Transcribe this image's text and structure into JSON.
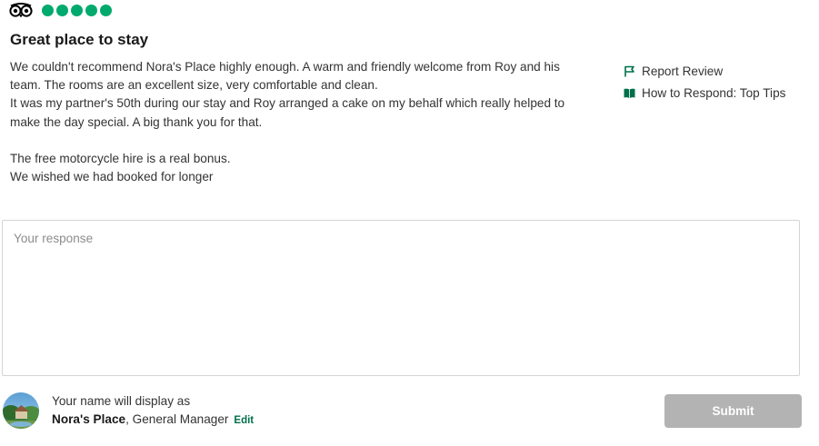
{
  "review": {
    "rating": {
      "value": 5,
      "max": 5,
      "color": "#00aa6c"
    },
    "title": "Great place to stay",
    "body_lines": [
      "We couldn't recommend Nora's Place highly enough. A warm and friendly welcome from Roy and his",
      "team. The rooms are an excellent size, very comfortable and clean.",
      "It was my partner's 50th during our stay and Roy arranged a cake on my behalf which really helped to",
      "make the day special. A big thank you for that.",
      "",
      "The free motorcycle hire is a real bonus.",
      "We wished we had booked for longer"
    ]
  },
  "side_links": {
    "report": {
      "label": "Report Review",
      "icon": "flag-icon"
    },
    "tips": {
      "label": "How to Respond: Top Tips",
      "icon": "book-icon"
    }
  },
  "response": {
    "placeholder": "Your response",
    "value": ""
  },
  "author": {
    "display_prefix": "Your name will display as",
    "name": "Nora's Place",
    "role": ", General Manager",
    "edit_label": "Edit",
    "accent_color": "#00704a"
  },
  "submit": {
    "label": "Submit",
    "disabled_color": "#b3b3b3"
  },
  "brand": {
    "logo_icon": "tripadvisor-owl-icon"
  }
}
